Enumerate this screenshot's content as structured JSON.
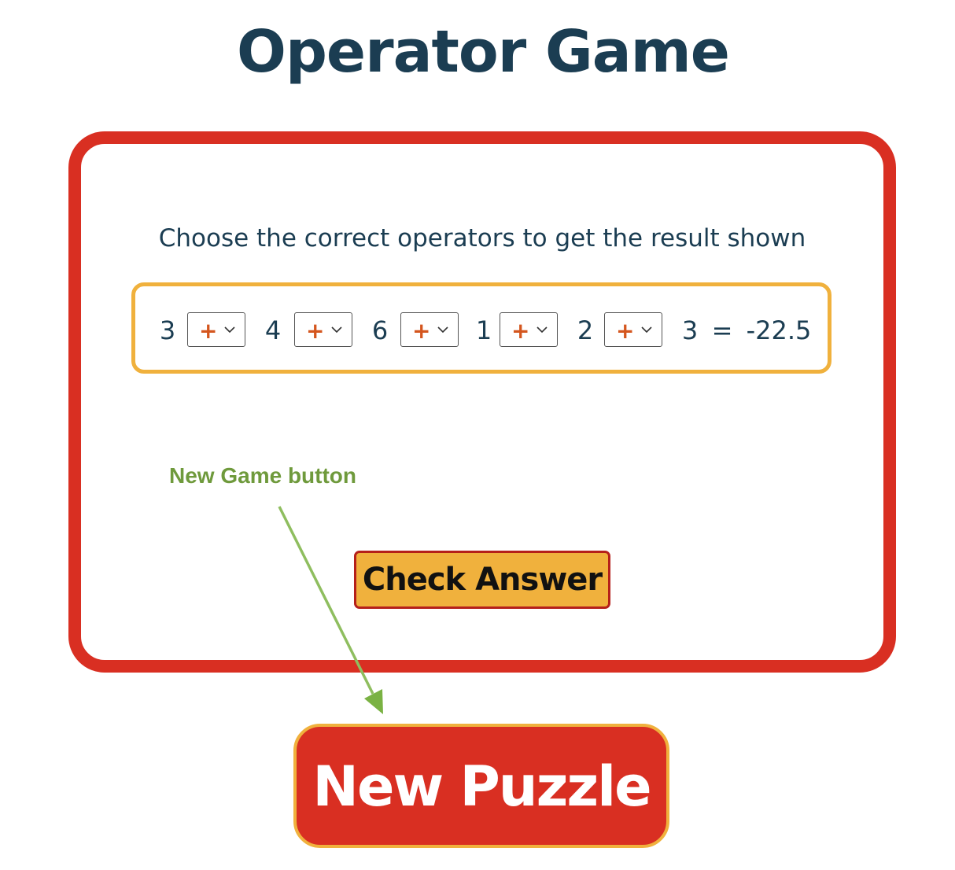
{
  "page": {
    "title": "Operator Game",
    "instruction": "Choose the correct operators to get the result shown"
  },
  "equation": {
    "numbers": [
      "3",
      "4",
      "6",
      "1",
      "2",
      "3"
    ],
    "operators": [
      "+",
      "+",
      "+",
      "+",
      "+"
    ],
    "equals": "=",
    "result": "-22.5"
  },
  "buttons": {
    "check_answer": "Check Answer",
    "new_puzzle": "New Puzzle"
  },
  "annotation": {
    "label": "New Game button"
  },
  "colors": {
    "title_text": "#1b3d52",
    "card_border": "#d92f22",
    "equation_border": "#f0b13d",
    "operator_text": "#d4561e",
    "check_button_bg": "#f0b13d",
    "new_puzzle_bg": "#d92f22",
    "annotation_text": "#6f9a3c"
  },
  "icons": {
    "select_chevron": "chevron-down-icon",
    "annotation_arrow": "arrow-icon"
  }
}
